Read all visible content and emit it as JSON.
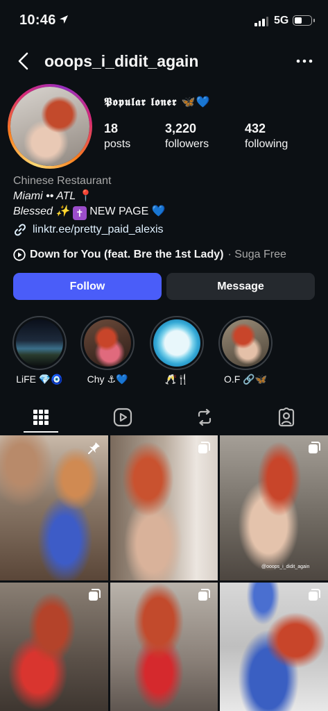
{
  "status_bar": {
    "time": "10:46",
    "network": "5G"
  },
  "header": {
    "username": "ooops_i_didit_again"
  },
  "profile": {
    "display_name": "𝕻𝖔𝖕𝖚𝖑𝖆𝖗 𝖑𝖔𝖓𝖊𝖗 🦋💙",
    "stats": [
      {
        "value": "18",
        "label": "posts"
      },
      {
        "value": "3,220",
        "label": "followers"
      },
      {
        "value": "432",
        "label": "following"
      }
    ],
    "bio": {
      "category": "Chinese Restaurant",
      "line1": "Miami •• ATL",
      "line1_icon": "📍",
      "line2_prefix": "Blessed ✨",
      "line2_badge": "✝",
      "line2_suffix": "NEW PAGE",
      "line2_heart": "💙",
      "link": "linktr.ee/pretty_paid_alexis"
    },
    "music": {
      "title": "Down for You (feat. Bre the 1st Lady)",
      "artist": "· Suga Free"
    }
  },
  "actions": {
    "follow_label": "Follow",
    "message_label": "Message"
  },
  "highlights": [
    {
      "label": "LiFE 💎🧿"
    },
    {
      "label": "Chy ⚓💙"
    },
    {
      "label": "🥂🍴"
    },
    {
      "label": "O.F 🔗🦋"
    }
  ],
  "tabs": [
    {
      "icon": "grid-icon",
      "active": true
    },
    {
      "icon": "reels-icon",
      "active": false
    },
    {
      "icon": "reposts-icon",
      "active": false
    },
    {
      "icon": "tagged-icon",
      "active": false
    }
  ],
  "posts": [
    {
      "badge": "pin-icon"
    },
    {
      "badge": "multi-post-icon"
    },
    {
      "badge": "multi-post-icon",
      "caption": "@ooops_i_didit_again"
    },
    {
      "badge": "multi-post-icon"
    },
    {
      "badge": "multi-post-icon"
    },
    {
      "badge": "multi-post-icon"
    }
  ],
  "colors": {
    "background": "#0c1014",
    "follow_button": "#4a5df9",
    "message_button": "#25292e",
    "link": "#e0f1ff",
    "secondary_text": "#a8a8a8"
  }
}
